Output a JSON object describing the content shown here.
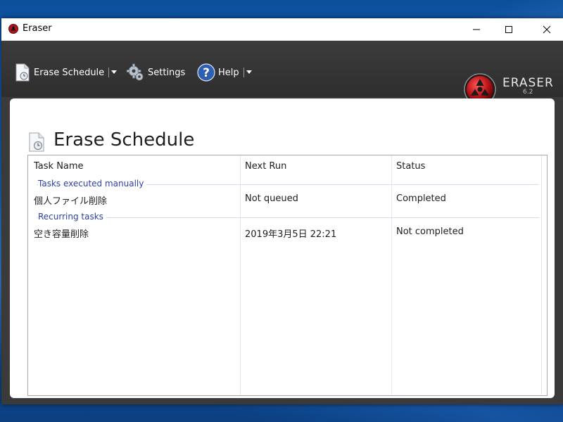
{
  "window": {
    "title": "Eraser"
  },
  "toolbar": {
    "erase_schedule": "Erase Schedule",
    "settings": "Settings",
    "help": "Help"
  },
  "logo": {
    "name": "ERASER",
    "version": "6.2"
  },
  "page": {
    "title": "Erase Schedule"
  },
  "table": {
    "columns": [
      "Task Name",
      "Next Run",
      "Status"
    ],
    "groups": [
      {
        "label": "Tasks executed manually",
        "rows": [
          {
            "task_name": "個人ファイル削除",
            "next_run": "Not queued",
            "status": "Completed"
          }
        ]
      },
      {
        "label": "Recurring tasks",
        "rows": [
          {
            "task_name": "空き容量削除",
            "next_run": "2019年3月5日 22:21",
            "status": "Not completed"
          }
        ]
      }
    ]
  },
  "icons": {
    "app": "eraser-app-icon",
    "erase_schedule": "schedule-document-icon",
    "settings": "gear-icon",
    "help": "help-question-icon"
  },
  "colors": {
    "toolbar_bg": "#333333",
    "group_label": "#2b3fa8",
    "logo_red": "#c0151b"
  }
}
